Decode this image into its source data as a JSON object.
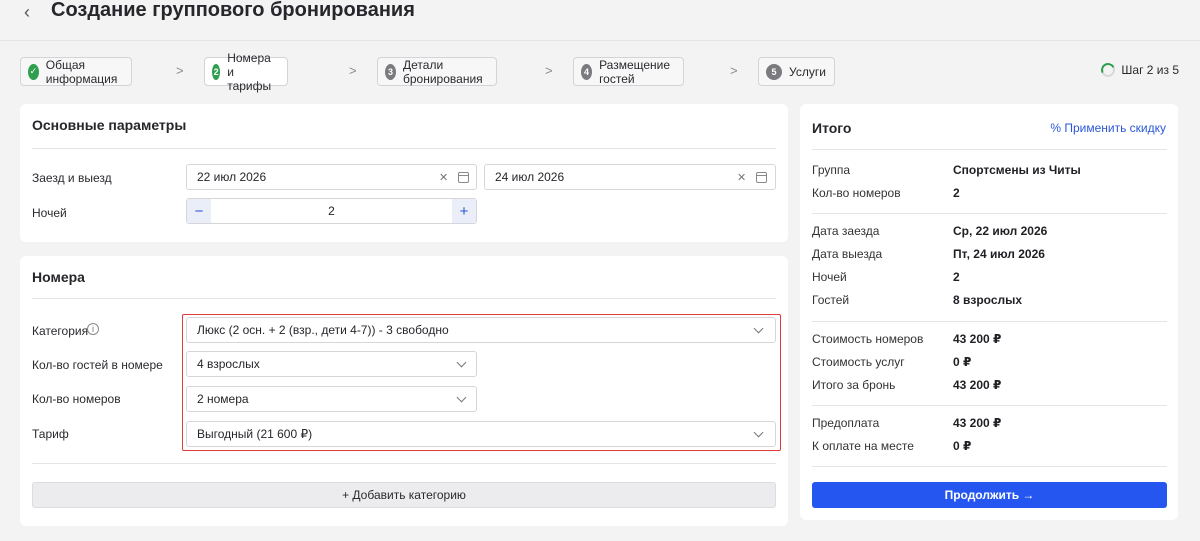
{
  "header": {
    "back_icon": "‹",
    "title": "Создание группового бронирования"
  },
  "steps": [
    {
      "num": "✓",
      "label": "Общая информация",
      "state": "done"
    },
    {
      "num": "2",
      "label": "Номера и тарифы",
      "state": "current"
    },
    {
      "num": "3",
      "label": "Детали бронирования",
      "state": "todo"
    },
    {
      "num": "4",
      "label": "Размещение гостей",
      "state": "todo"
    },
    {
      "num": "5",
      "label": "Услуги",
      "state": "todo"
    }
  ],
  "step_separator": ">",
  "step_counter": "Шаг 2 из 5",
  "basic": {
    "title": "Основные параметры",
    "dates_label": "Заезд и выезд",
    "checkin": "22 июл 2026",
    "checkout": "24 июл 2026",
    "clear_icon": "✕",
    "nights_label": "Ночей",
    "nights_value": "2",
    "minus": "−",
    "plus": "+"
  },
  "rooms": {
    "title": "Номера",
    "category_label": "Категория",
    "info_icon": "i",
    "category_value": "Люкс (2 осн. + 2 (взр., дети 4-7)) - 3 свободно",
    "guests_label": "Кол-во гостей в номере",
    "guests_value": "4 взрослых",
    "count_label": "Кол-во номеров",
    "count_value": "2 номера",
    "tariff_label": "Тариф",
    "tariff_value": "Выгодный (21 600 ₽)",
    "add_category": "+ Добавить категорию"
  },
  "summary": {
    "title": "Итого",
    "apply_discount": "% Применить скидку",
    "group_label": "Группа",
    "group_value": "Спортсмены из Читы",
    "rooms_count_label": "Кол-во номеров",
    "rooms_count_value": "2",
    "checkin_label": "Дата заезда",
    "checkin_value": "Ср, 22 июл 2026",
    "checkout_label": "Дата выезда",
    "checkout_value": "Пт, 24 июл 2026",
    "nights_label": "Ночей",
    "nights_value": "2",
    "guests_label": "Гостей",
    "guests_value": "8 взрослых",
    "rooms_cost_label": "Стоимость номеров",
    "rooms_cost_value": "43 200 ₽",
    "services_cost_label": "Стоимость услуг",
    "services_cost_value": "0 ₽",
    "total_label": "Итого за бронь",
    "total_value": "43 200 ₽",
    "prepay_label": "Предоплата",
    "prepay_value": "43 200 ₽",
    "onsite_label": "К оплате на месте",
    "onsite_value": "0 ₽",
    "continue": "Продолжить →"
  },
  "colors": {
    "accent": "#2557f0",
    "success": "#2e9e4f",
    "highlight": "#e23b3b"
  }
}
